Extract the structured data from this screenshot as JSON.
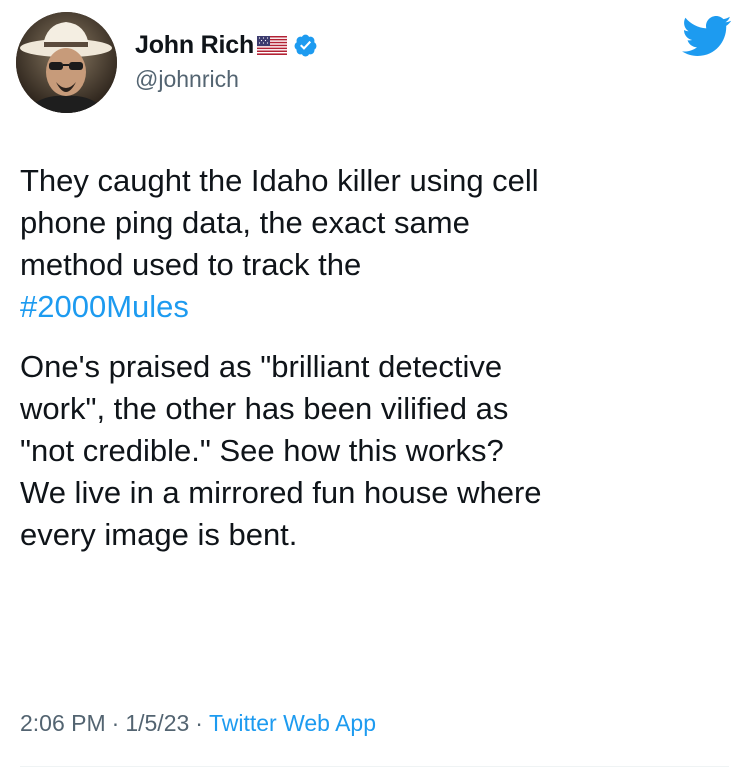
{
  "author": {
    "display_name": "John Rich",
    "handle": "@johnrich",
    "flag_icon": "us-flag-icon",
    "verified_icon": "verified-badge-icon",
    "verified_color": "#1d9bf0"
  },
  "brand": {
    "icon": "twitter-bird-icon",
    "color": "#1d9bf0"
  },
  "tweet": {
    "line1_before": "They caught the Idaho killer using cell\nphone ping data, the exact same\nmethod used to track the\n",
    "hashtag": "#2000Mules",
    "paragraph2": "One's praised as \"brilliant detective\nwork\", the other has been vilified as\n\"not credible.\" See how this works?\nWe live in a mirrored fun house where\nevery image is bent."
  },
  "meta": {
    "time": "2:06 PM",
    "separator": "·",
    "date": "1/5/23",
    "source": "Twitter Web App"
  }
}
